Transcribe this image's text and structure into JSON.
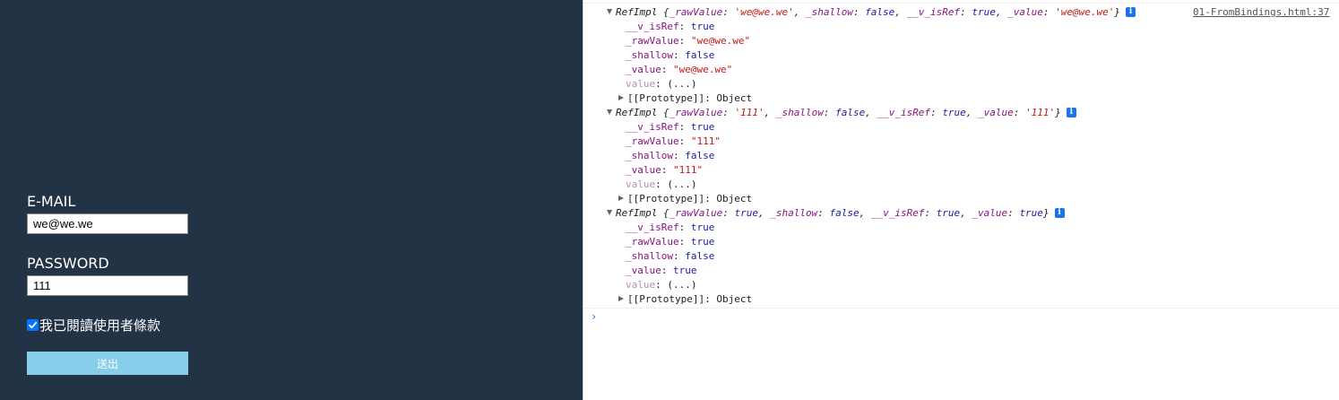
{
  "form": {
    "email_label": "E-MAIL",
    "email_value": "we@we.we",
    "password_label": "PASSWORD",
    "password_value": "111",
    "agree_checked": true,
    "agree_label": "我已閱讀使用者條款",
    "submit_label": "送出"
  },
  "console": {
    "source_link": "01-FromBindings.html:37",
    "prompt_symbol": "›",
    "entries": [
      {
        "class_name": "RefImpl",
        "summary_open": " {",
        "summary_close": "}",
        "info_glyph": "i",
        "summary_fields": [
          {
            "key": "_rawValue",
            "value": "'we@we.we'",
            "type": "string"
          },
          {
            "key": "_shallow",
            "value": "false",
            "type": "bool"
          },
          {
            "key": "__v_isRef",
            "value": "true",
            "type": "bool"
          },
          {
            "key": "_value",
            "value": "'we@we.we'",
            "type": "string"
          }
        ],
        "props": [
          {
            "key": "__v_isRef",
            "value": "true",
            "type": "bool"
          },
          {
            "key": "_rawValue",
            "value": "\"we@we.we\"",
            "type": "string"
          },
          {
            "key": "_shallow",
            "value": "false",
            "type": "bool"
          },
          {
            "key": "_value",
            "value": "\"we@we.we\"",
            "type": "string"
          },
          {
            "key": "value",
            "value": "(...)",
            "type": "getter"
          }
        ],
        "prototype_key": "[[Prototype]]",
        "prototype_value": "Object"
      },
      {
        "class_name": "RefImpl",
        "summary_open": " {",
        "summary_close": "}",
        "info_glyph": "i",
        "summary_fields": [
          {
            "key": "_rawValue",
            "value": "'111'",
            "type": "string"
          },
          {
            "key": "_shallow",
            "value": "false",
            "type": "bool"
          },
          {
            "key": "__v_isRef",
            "value": "true",
            "type": "bool"
          },
          {
            "key": "_value",
            "value": "'111'",
            "type": "string"
          }
        ],
        "props": [
          {
            "key": "__v_isRef",
            "value": "true",
            "type": "bool"
          },
          {
            "key": "_rawValue",
            "value": "\"111\"",
            "type": "string"
          },
          {
            "key": "_shallow",
            "value": "false",
            "type": "bool"
          },
          {
            "key": "_value",
            "value": "\"111\"",
            "type": "string"
          },
          {
            "key": "value",
            "value": "(...)",
            "type": "getter"
          }
        ],
        "prototype_key": "[[Prototype]]",
        "prototype_value": "Object"
      },
      {
        "class_name": "RefImpl",
        "summary_open": " {",
        "summary_close": "}",
        "info_glyph": "i",
        "summary_fields": [
          {
            "key": "_rawValue",
            "value": "true",
            "type": "bool"
          },
          {
            "key": "_shallow",
            "value": "false",
            "type": "bool"
          },
          {
            "key": "__v_isRef",
            "value": "true",
            "type": "bool"
          },
          {
            "key": "_value",
            "value": "true",
            "type": "bool"
          }
        ],
        "props": [
          {
            "key": "__v_isRef",
            "value": "true",
            "type": "bool"
          },
          {
            "key": "_rawValue",
            "value": "true",
            "type": "bool"
          },
          {
            "key": "_shallow",
            "value": "false",
            "type": "bool"
          },
          {
            "key": "_value",
            "value": "true",
            "type": "bool"
          },
          {
            "key": "value",
            "value": "(...)",
            "type": "getter"
          }
        ],
        "prototype_key": "[[Prototype]]",
        "prototype_value": "Object"
      }
    ]
  },
  "colors": {
    "app_background": "#233346",
    "submit_button": "#87ceeb",
    "checkbox_accent": "#0075ff",
    "console_key": "#881280",
    "console_string": "#c41a16",
    "console_boolean": "#1a1aa6",
    "info_badge": "#1a73e8"
  }
}
